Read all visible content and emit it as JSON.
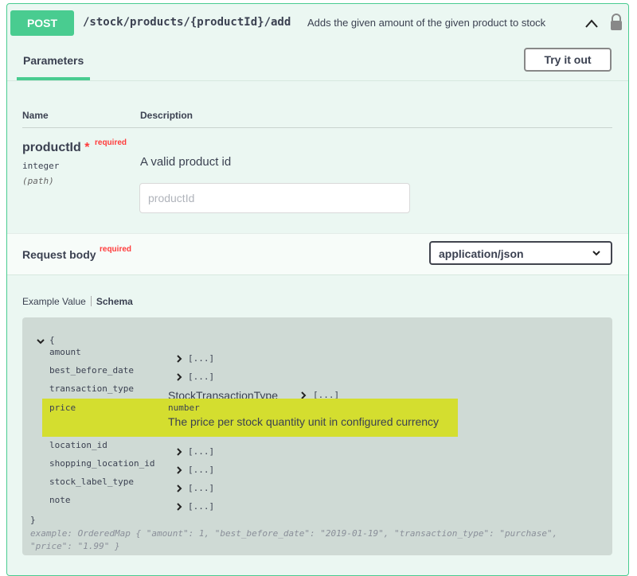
{
  "summary": {
    "method": "POST",
    "path": "/stock/products/{productId}/add",
    "description": "Adds the given amount of the given product to stock"
  },
  "tabs": {
    "parameters": "Parameters",
    "try_it_out": "Try it out"
  },
  "parameters": {
    "col_name": "Name",
    "col_description": "Description",
    "items": [
      {
        "name": "productId",
        "required_marker": "*",
        "required_label": "required",
        "type": "integer",
        "in": "(path)",
        "description": "A valid product id",
        "placeholder": "productId"
      }
    ]
  },
  "request_body": {
    "title": "Request body",
    "required_label": "required",
    "content_type": "application/json"
  },
  "schema_tabs": {
    "example_value": "Example Value",
    "schema": "Schema"
  },
  "schema": {
    "open_brace": "{",
    "close_brace": "}",
    "collapsed": "[...]",
    "properties": [
      {
        "name": "amount"
      },
      {
        "name": "best_before_date"
      },
      {
        "name": "transaction_type",
        "ref": "StockTransactionType"
      },
      {
        "name": "price",
        "type": "number",
        "description": "The price per stock quantity unit in configured currency"
      },
      {
        "name": "location_id"
      },
      {
        "name": "shopping_location_id"
      },
      {
        "name": "stock_label_type"
      },
      {
        "name": "note"
      }
    ],
    "example": "example: OrderedMap { \"amount\": 1, \"best_before_date\": \"2019-01-19\", \"transaction_type\": \"purchase\", \"price\": \"1.99\" }"
  },
  "colors": {
    "post_green": "#49cc90",
    "block_bg": "#ebf7f2",
    "schema_bg": "#cfdad5",
    "highlight": "#d4de2f",
    "required_red": "#ff3b3b"
  }
}
